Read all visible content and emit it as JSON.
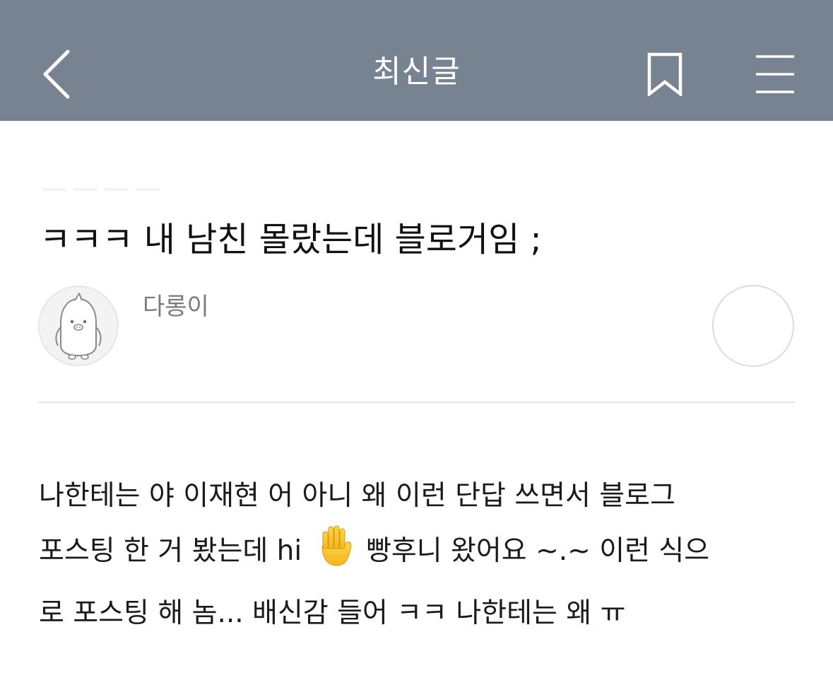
{
  "nav": {
    "title": "최신글",
    "back_icon": "chevron-left-icon",
    "bookmark_icon": "bookmark-icon",
    "menu_icon": "hamburger-menu-icon"
  },
  "colors": {
    "navbar_bg": "#788391",
    "nav_text": "#ffffff",
    "title_text": "#111111",
    "author_text": "#7b7b7b",
    "divider": "#e6e6e6"
  },
  "post": {
    "title": "ㅋㅋㅋ 내 남친 몰랐는데 블로거임 ;",
    "author": {
      "name": "다롱이",
      "avatar_icon": "penguin-avatar-icon"
    },
    "follow_icon": "circle-icon",
    "body": {
      "line1": "나한테는 야 이재현 어 아니 왜 이런 단답 쓰면서 블로그",
      "line2_before_emoji": "포스팅 한 거 봤는데 hi",
      "emoji_icon": "raised-hand-emoji-icon",
      "line2_after_emoji": "빵후니 왔어요 ~.~ 이런 식으",
      "line3": "로 포스팅 해 놈... 배신감 들어 ㅋㅋ 나한테는 왜 ㅠ"
    }
  }
}
